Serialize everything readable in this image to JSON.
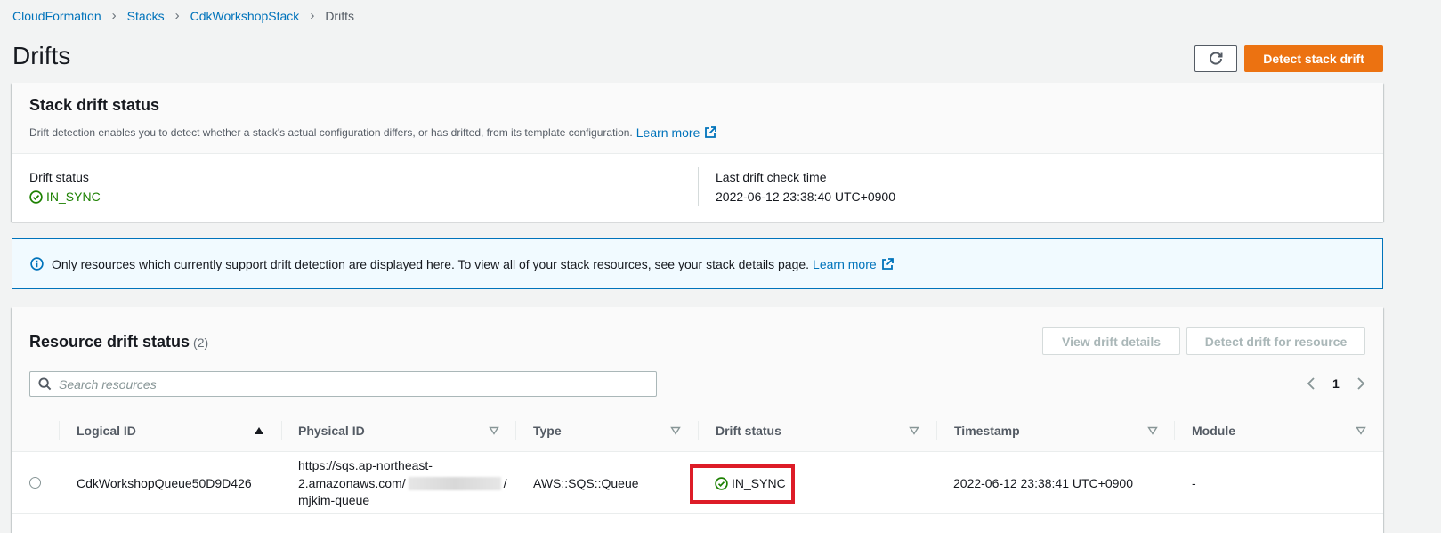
{
  "breadcrumb": {
    "items": [
      "CloudFormation",
      "Stacks",
      "CdkWorkshopStack"
    ],
    "current": "Drifts"
  },
  "page": {
    "title": "Drifts",
    "detect_stack_drift_label": "Detect stack drift"
  },
  "stack_drift": {
    "heading": "Stack drift status",
    "description": "Drift detection enables you to detect whether a stack's actual configuration differs, or has drifted, from its template configuration.",
    "learn_more": "Learn more",
    "drift_status_label": "Drift status",
    "drift_status_value": "IN_SYNC",
    "last_check_label": "Last drift check time",
    "last_check_value": "2022-06-12 23:38:40 UTC+0900"
  },
  "info": {
    "text": "Only resources which currently support drift detection are displayed here. To view all of your stack resources, see your stack details page.",
    "learn_more": "Learn more"
  },
  "resources": {
    "heading": "Resource drift status",
    "count": "(2)",
    "view_details_label": "View drift details",
    "detect_resource_label": "Detect drift for resource",
    "search_placeholder": "Search resources",
    "page_number": "1",
    "columns": [
      "Logical ID",
      "Physical ID",
      "Type",
      "Drift status",
      "Timestamp",
      "Module"
    ],
    "rows": [
      {
        "logical_id": "CdkWorkshopQueue50D9D426",
        "physical_id_line1": "https://sqs.ap-northeast-",
        "physical_id_line2a": "2.amazonaws.com/",
        "physical_id_line2b": "/",
        "physical_id_line3": "mjkim-queue",
        "type": "AWS::SQS::Queue",
        "drift_status": "IN_SYNC",
        "timestamp": "2022-06-12 23:38:41 UTC+0900",
        "module": "-"
      }
    ]
  },
  "colors": {
    "accent": "#ec7211",
    "link": "#0073bb",
    "success": "#1d8102",
    "highlight": "#dd1c27"
  }
}
